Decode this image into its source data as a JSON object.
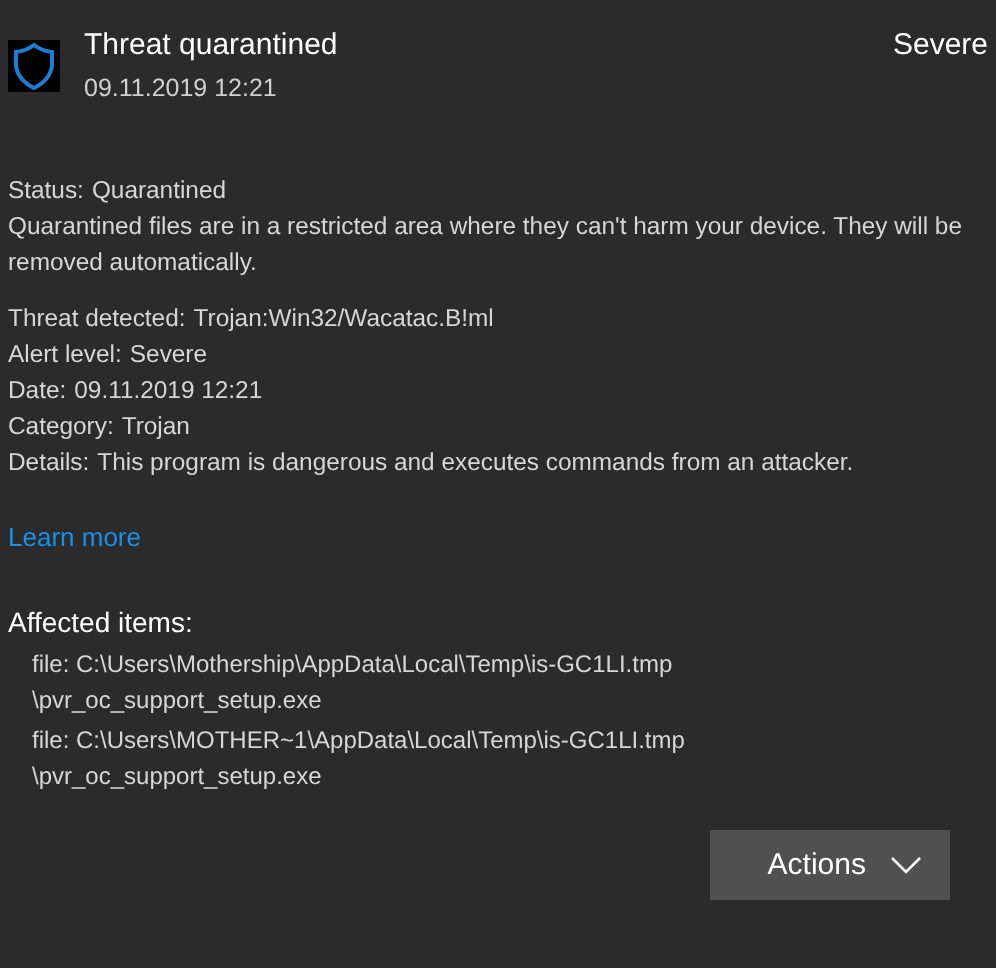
{
  "header": {
    "title": "Threat quarantined",
    "date": "09.11.2019 12:21",
    "severity": "Severe"
  },
  "status": {
    "label": "Status:",
    "value": "Quarantined",
    "description": "Quarantined files are in a restricted area where they can't harm your device. They will be removed automatically."
  },
  "details": [
    {
      "label": "Threat detected:",
      "value": "Trojan:Win32/Wacatac.B!ml"
    },
    {
      "label": "Alert level:",
      "value": "Severe"
    },
    {
      "label": "Date:",
      "value": "09.11.2019 12:21"
    },
    {
      "label": "Category:",
      "value": "Trojan"
    },
    {
      "label": "Details:",
      "value": "This program is dangerous and executes commands from an attacker."
    }
  ],
  "link": "Learn more",
  "affected_items": {
    "title": "Affected items:",
    "items": [
      {
        "lines": [
          "file: C:\\Users\\Mothership\\AppData\\Local\\Temp\\is-GC1LI.tmp",
          "\\pvr_oc_support_setup.exe"
        ]
      },
      {
        "lines": [
          "file: C:\\Users\\MOTHER~1\\AppData\\Local\\Temp\\is-GC1LI.tmp",
          "\\pvr_oc_support_setup.exe"
        ]
      }
    ]
  },
  "actions_button": "Actions"
}
